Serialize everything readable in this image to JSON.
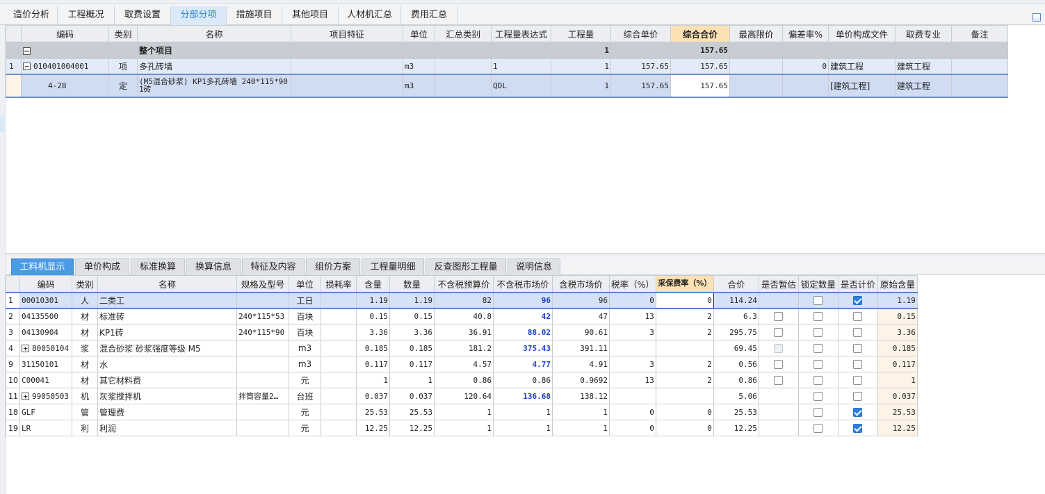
{
  "main_tabs": [
    "造价分析",
    "工程概况",
    "取费设置",
    "分部分项",
    "措施项目",
    "其他项目",
    "人材机汇总",
    "费用汇总"
  ],
  "top_grid": {
    "headers": [
      "编码",
      "类别",
      "名称",
      "项目特征",
      "单位",
      "汇总类别",
      "工程量表达式",
      "工程量",
      "综合单价",
      "综合合价",
      "最高限价",
      "偏差率%",
      "单价构成文件",
      "取费专业",
      "备注"
    ],
    "summary": {
      "name": "整个项目",
      "qty": "1",
      "total": "157.65"
    },
    "item": {
      "row": "1",
      "code": "010401004001",
      "type": "项",
      "name": "多孔砖墙",
      "unit": "m3",
      "expr": "1",
      "qty": "1",
      "price": "157.65",
      "total": "157.65",
      "dev": "0",
      "file": "建筑工程",
      "major": "建筑工程"
    },
    "sub": {
      "code": "4-28",
      "type": "定",
      "name": "(M5混合砂浆) KP1多孔砖墙 240*115*90 1砖",
      "unit": "m3",
      "expr": "QDL",
      "qty": "1",
      "price": "157.65",
      "total": "157.65",
      "file": "[建筑工程]",
      "major": "建筑工程"
    }
  },
  "bottom_tabs": [
    "工料机显示",
    "单价构成",
    "标准换算",
    "换算信息",
    "特征及内容",
    "组价方案",
    "工程量明细",
    "反查图形工程量",
    "说明信息"
  ],
  "bottom_grid": {
    "headers": [
      "编码",
      "类别",
      "名称",
      "规格及型号",
      "单位",
      "损耗率",
      "含量",
      "数量",
      "不含税预算价",
      "不含税市场价",
      "含税市场价",
      "税率（%）",
      "采保费率（%）",
      "合价",
      "是否暂估",
      "锁定数量",
      "是否计价",
      "原始含量"
    ],
    "rows": [
      {
        "rn": "1",
        "code": "00010301",
        "type": "人",
        "name": "二类工",
        "spec": "",
        "unit": "工日",
        "loss": "",
        "content": "1.19",
        "amount": "1.19",
        "budget": "82",
        "market": "96",
        "market_tax": "96",
        "tax": "0",
        "fee": "0",
        "total": "114.24",
        "temp": "none",
        "lock": "off",
        "price": "on",
        "orig": "1.19"
      },
      {
        "rn": "2",
        "code": "04135500",
        "type": "材",
        "name": "标准砖",
        "spec": "240*115*53",
        "unit": "百块",
        "loss": "",
        "content": "0.15",
        "amount": "0.15",
        "budget": "40.8",
        "market": "42",
        "market_tax": "47",
        "tax": "13",
        "fee": "2",
        "total": "6.3",
        "temp": "off",
        "lock": "off",
        "price": "off",
        "orig": "0.15"
      },
      {
        "rn": "3",
        "code": "04130904",
        "type": "材",
        "name": "KP1砖",
        "spec": "240*115*90",
        "unit": "百块",
        "loss": "",
        "content": "3.36",
        "amount": "3.36",
        "budget": "36.91",
        "market": "88.02",
        "market_tax": "90.61",
        "tax": "3",
        "fee": "2",
        "total": "295.75",
        "temp": "off",
        "lock": "off",
        "price": "off",
        "orig": "3.36"
      },
      {
        "rn": "4",
        "code": "80050104",
        "type": "浆",
        "name": "混合砂浆 砂浆强度等级 M5",
        "spec": "",
        "unit": "m3",
        "loss": "",
        "content": "0.185",
        "amount": "0.185",
        "budget": "181.2",
        "market": "375.43",
        "market_tax": "391.11",
        "tax": "",
        "fee": "",
        "total": "69.45",
        "temp": "dis",
        "lock": "off",
        "price": "off",
        "orig": "0.185",
        "expand": true
      },
      {
        "rn": "9",
        "code": "31150101",
        "type": "材",
        "name": "水",
        "spec": "",
        "unit": "m3",
        "loss": "",
        "content": "0.117",
        "amount": "0.117",
        "budget": "4.57",
        "market": "4.77",
        "market_tax": "4.91",
        "tax": "3",
        "fee": "2",
        "total": "0.56",
        "temp": "off",
        "lock": "off",
        "price": "off",
        "orig": "0.117"
      },
      {
        "rn": "10",
        "code": "C00041",
        "type": "材",
        "name": "其它材料费",
        "spec": "",
        "unit": "元",
        "loss": "",
        "content": "1",
        "amount": "1",
        "budget": "0.86",
        "market": "0.86",
        "market_tax": "0.9692",
        "tax": "13",
        "fee": "2",
        "total": "0.86",
        "temp": "off",
        "lock": "off",
        "price": "off",
        "orig": "1"
      },
      {
        "rn": "11",
        "code": "99050503",
        "type": "机",
        "name": "灰浆搅拌机",
        "spec": "拌筒容量2…",
        "unit": "台班",
        "loss": "",
        "content": "0.037",
        "amount": "0.037",
        "budget": "120.64",
        "market": "136.68",
        "market_tax": "138.12",
        "tax": "",
        "fee": "",
        "total": "5.06",
        "temp": "none",
        "lock": "off",
        "price": "off",
        "orig": "0.037",
        "expand": true
      },
      {
        "rn": "18",
        "code": "GLF",
        "type": "管",
        "name": "管理费",
        "spec": "",
        "unit": "元",
        "loss": "",
        "content": "25.53",
        "amount": "25.53",
        "budget": "1",
        "market": "1",
        "market_tax": "1",
        "tax": "0",
        "fee": "0",
        "total": "25.53",
        "temp": "none",
        "lock": "off",
        "price": "on",
        "orig": "25.53"
      },
      {
        "rn": "19",
        "code": "LR",
        "type": "利",
        "name": "利润",
        "spec": "",
        "unit": "元",
        "loss": "",
        "content": "12.25",
        "amount": "12.25",
        "budget": "1",
        "market": "1",
        "market_tax": "1",
        "tax": "0",
        "fee": "0",
        "total": "12.25",
        "temp": "none",
        "lock": "off",
        "price": "on",
        "orig": "12.25"
      }
    ]
  },
  "icons": {
    "tree_collapse": "−",
    "tree_expand": "+",
    "toolbar_icon": "chart-icon"
  }
}
